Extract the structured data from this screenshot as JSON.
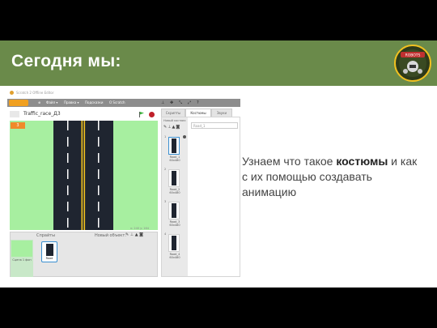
{
  "slide": {
    "title": "Сегодня мы:",
    "description_pre": "Узнаем что такое ",
    "description_bold": "костюмы",
    "description_post": " и как с их помощью создавать анимацию",
    "colors": {
      "title_bar": "#6a8a4a",
      "title_text": "#ffffff"
    }
  },
  "scratch": {
    "window_title": "Scratch 2 Offline Editor",
    "menu": {
      "file": "Файл ▾",
      "edit": "Правка ▾",
      "tips": "Подсказки",
      "about": "О Scratch"
    },
    "project_name": "Traffic_race_Д3",
    "version_label": "v.461",
    "variable_value": "3",
    "sprites_header": "Спрайты",
    "new_object_label": "Новый объект:",
    "stage_label": "Сцена\n1 фон",
    "sprite_name": "Road",
    "cursor_pos": "x: 240  y: 164",
    "tabs": [
      "Скрипты",
      "Костюмы",
      "Звуки"
    ],
    "new_costume_label": "Новый костюм:",
    "costume_name_value": "Road_1",
    "costumes": [
      {
        "num": "1",
        "name": "Road_1",
        "size": "60x480"
      },
      {
        "num": "2",
        "name": "Road_2",
        "size": "60x480"
      },
      {
        "num": "3",
        "name": "Road_3",
        "size": "60x480"
      },
      {
        "num": "4",
        "name": "Road_4",
        "size": "60x480"
      }
    ]
  }
}
